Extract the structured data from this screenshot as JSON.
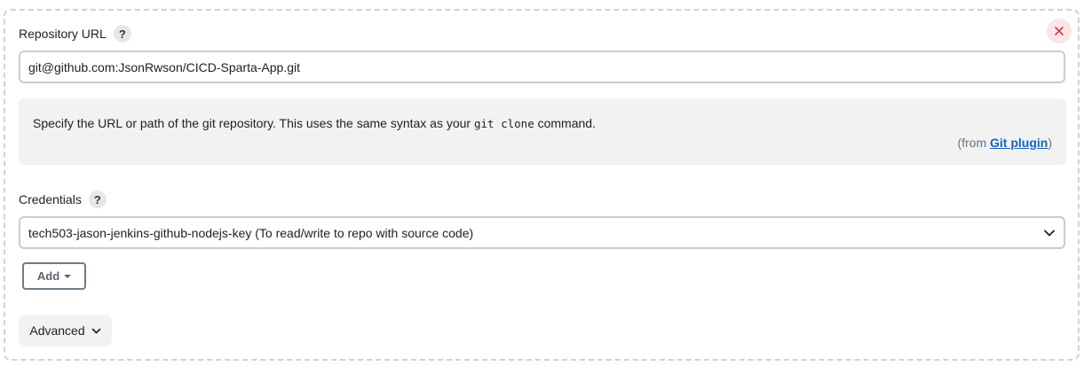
{
  "repository": {
    "label": "Repository URL",
    "help_icon": "?",
    "url_value": "git@github.com:JsonRwson/CICD-Sparta-App.git"
  },
  "help": {
    "text_before": "Specify the URL or path of the git repository. This uses the same syntax as your ",
    "code": "git clone",
    "text_after": " command.",
    "from_prefix": "(from ",
    "plugin_link": "Git plugin",
    "from_suffix": ")"
  },
  "credentials": {
    "label": "Credentials",
    "help_icon": "?",
    "selected": "tech503-jason-jenkins-github-nodejs-key (To read/write to repo with source code)"
  },
  "buttons": {
    "add": "Add",
    "advanced": "Advanced"
  },
  "icons": {
    "close": "close-icon",
    "help": "question-mark-icon",
    "dropdown": "chevron-down-icon",
    "add_caret": "caret-down-icon"
  },
  "colors": {
    "close_bg": "#fde4e6",
    "close_x": "#d63a4a",
    "link": "#1565c0",
    "help_box_bg": "#f2f2f3",
    "dashed_border": "#cfd2d6"
  }
}
